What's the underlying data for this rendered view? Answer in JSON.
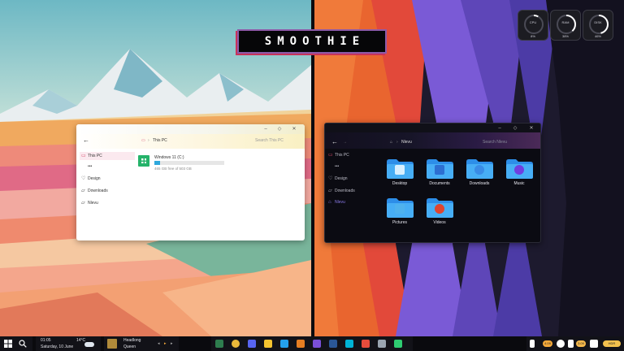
{
  "banner": {
    "title": "SMOOTHIE"
  },
  "gauges": [
    {
      "name": "CPU",
      "value": "8%",
      "fraction": 0.08
    },
    {
      "name": "RAM",
      "value": "38%",
      "fraction": 0.38
    },
    {
      "name": "DISK",
      "value": "46%",
      "fraction": 0.46
    }
  ],
  "light_window": {
    "window_controls": [
      "‒",
      "◇",
      "✕"
    ],
    "back": "←",
    "breadcrumb": "This PC",
    "search_placeholder": "Search This PC",
    "nav": [
      {
        "label": "This PC",
        "icon": "monitor-icon",
        "selected": true
      },
      {
        "label": "•••",
        "icon": "",
        "selected": false
      },
      {
        "label": "Design",
        "icon": "heart-icon",
        "selected": false
      },
      {
        "label": "Downloads",
        "icon": "folder-icon",
        "selected": false
      },
      {
        "label": "Nlevu",
        "icon": "folder-icon",
        "selected": false
      }
    ],
    "drive": {
      "name": "Windows 11 (C:)",
      "free_text": "465 GB free of 503 GB",
      "used_fraction": 0.08
    }
  },
  "dark_window": {
    "window_controls": [
      "‒",
      "◇",
      "✕"
    ],
    "back": "←",
    "breadcrumb": "Nlevu",
    "search_placeholder": "Search Nlevu",
    "nav": [
      {
        "label": "This PC",
        "icon": "monitor-icon",
        "selected": false
      },
      {
        "label": "•••",
        "icon": "",
        "selected": false
      },
      {
        "label": "Design",
        "icon": "heart-icon",
        "selected": false
      },
      {
        "label": "Downloads",
        "icon": "folder-icon",
        "selected": false
      },
      {
        "label": "Nlevu",
        "icon": "home-icon",
        "selected": true
      }
    ],
    "folders": [
      {
        "label": "Desktop",
        "icon": "desktop-icon",
        "color": "#4fb2ee"
      },
      {
        "label": "Documents",
        "icon": "documents-icon",
        "color": "#2d6fd1"
      },
      {
        "label": "Downloads",
        "icon": "download-icon",
        "color": "#3a8ce6"
      },
      {
        "label": "Music",
        "icon": "music-icon",
        "color": "#6f3fe0"
      },
      {
        "label": "Pictures",
        "icon": "pictures-icon",
        "color": "#4fb2ee"
      },
      {
        "label": "Videos",
        "icon": "videos-icon",
        "color": "#e0452f"
      }
    ]
  },
  "taskbar": {
    "time": "01:05",
    "date": "Saturday, 10 June",
    "temperature": "14°C",
    "media_title": "Headlong",
    "media_artist": "Queen",
    "media_controls": [
      "◂",
      "▸",
      "▸"
    ],
    "tray_pills": [
      "4.09",
      "3.09",
      "HDR"
    ],
    "tray_pill_colors": [
      "#f4a93a",
      "#f4b84b",
      "#f2c14e"
    ],
    "accent": "#8a7ae8"
  }
}
